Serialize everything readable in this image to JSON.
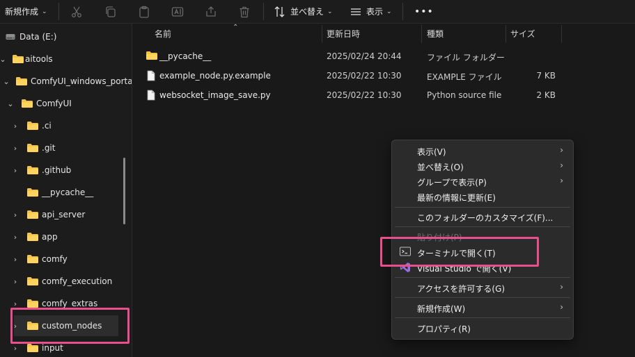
{
  "toolbar": {
    "new_label": "新規作成",
    "sort_label": "並べ替え",
    "view_label": "表示",
    "more_label": "•••"
  },
  "sidebar": {
    "items": [
      {
        "label": "Data (E:)"
      },
      {
        "label": "aitools"
      },
      {
        "label": "ComfyUI_windows_porta"
      },
      {
        "label": "ComfyUI"
      },
      {
        "label": ".ci"
      },
      {
        "label": ".git"
      },
      {
        "label": ".github"
      },
      {
        "label": "__pycache__"
      },
      {
        "label": "api_server"
      },
      {
        "label": "app"
      },
      {
        "label": "comfy"
      },
      {
        "label": "comfy_execution"
      },
      {
        "label": "comfy_extras"
      },
      {
        "label": "custom_nodes"
      },
      {
        "label": "input"
      }
    ]
  },
  "columns": {
    "name": "名前",
    "date": "更新日時",
    "type": "種類",
    "size": "サイズ"
  },
  "files": [
    {
      "name": "__pycache__",
      "date": "2025/02/24 20:44",
      "type": "ファイル フォルダー",
      "size": ""
    },
    {
      "name": "example_node.py.example",
      "date": "2025/02/22 10:30",
      "type": "EXAMPLE ファイル",
      "size": "7 KB"
    },
    {
      "name": "websocket_image_save.py",
      "date": "2025/02/22 10:30",
      "type": "Python source file",
      "size": "2 KB"
    }
  ],
  "context_menu": {
    "view": "表示(V)",
    "sort": "並べ替え(O)",
    "group": "グループで表示(P)",
    "refresh": "最新の情報に更新(E)",
    "customize": "このフォルダーのカスタマイズ(F)...",
    "paste": "貼り付け(P)",
    "terminal": "ターミナルで開く(T)",
    "visual_studio": "Visual Studio で開く(V)",
    "access": "アクセスを許可する(G)",
    "new": "新規作成(W)",
    "properties": "プロパティ(R)"
  },
  "colors": {
    "highlight": "#ea4f8d",
    "folder": "#f3c247",
    "background": "#191919",
    "menu": "#2b2b2b"
  }
}
